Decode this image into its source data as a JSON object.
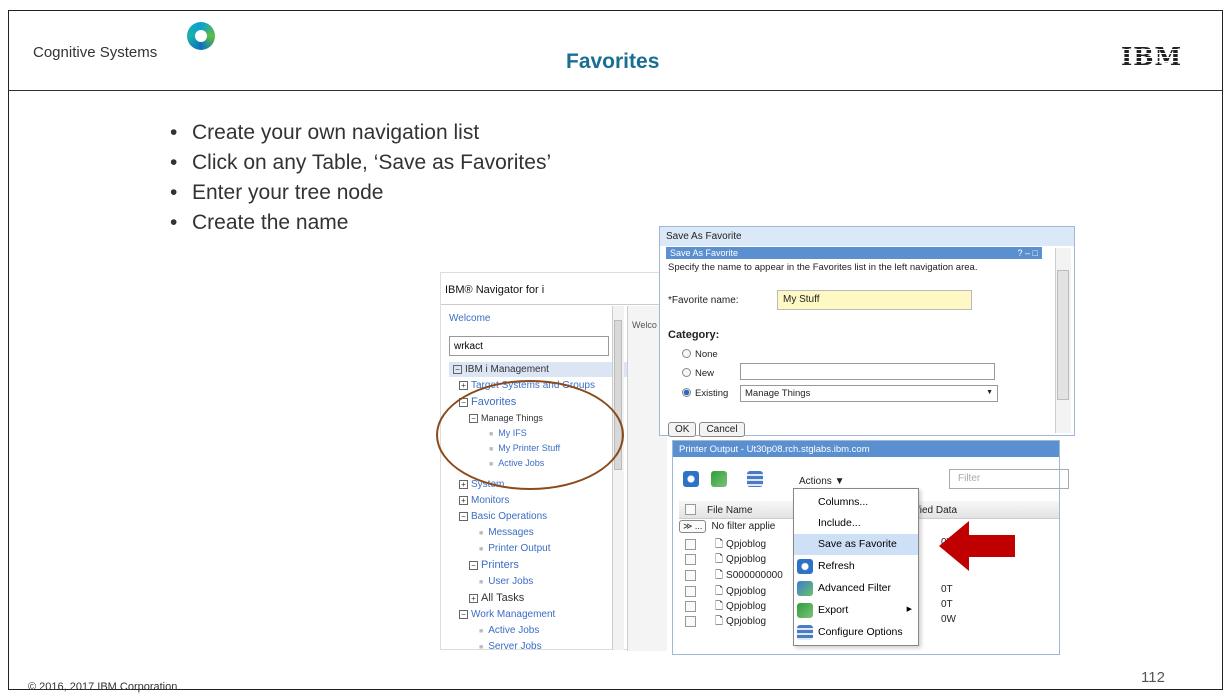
{
  "header": {
    "brand": "Cognitive Systems",
    "title": "Favorites",
    "logo_text": "IBM"
  },
  "bullets": [
    "Create your own navigation list",
    "Click on any Table, ‘Save as Favorites’",
    "Enter your tree node",
    "Create the name"
  ],
  "footer": {
    "copyright": "© 2016, 2017 IBM Corporation",
    "page": "112"
  },
  "navigator": {
    "title": "IBM® Navigator for i",
    "welcome": "Welcome",
    "search_value": "wrkact",
    "root": "IBM i Management",
    "items": [
      "Target Systems and Groups",
      "Favorites",
      "Manage Things",
      "My IFS",
      "My Printer Stuff",
      "Active Jobs",
      "System",
      "Monitors",
      "Basic Operations",
      "Messages",
      "Printer Output",
      "Printers",
      "User Jobs",
      "All Tasks",
      "Work Management",
      "Active Jobs",
      "Server Jobs"
    ],
    "behind_tab": "Welco"
  },
  "dialog": {
    "outer_title": "Save As Favorite",
    "inner_title": "Save As Favorite",
    "controls": "? – □",
    "description": "Specify the name to appear in the Favorites list in the left navigation area.",
    "favorite_name_label": "*Favorite name:",
    "favorite_name_value": "My Stuff",
    "category_label": "Category:",
    "radio_none": "None",
    "radio_new": "New",
    "radio_existing": "Existing",
    "existing_value": "Manage Things",
    "ok": "OK",
    "cancel": "Cancel"
  },
  "printer_output": {
    "title": "Printer Output - Ut30p08.rch.stglabs.ibm.com",
    "actions_label": "Actions ▼",
    "filter_placeholder": "Filter",
    "col_file_name": "File Name",
    "col_modified": "fied Data",
    "filter_button": "≫ ...",
    "filter_text": "No filter applie",
    "rows": [
      {
        "name": "Qpjoblog",
        "tail": "0V"
      },
      {
        "name": "Qpjoblog",
        "tail": ""
      },
      {
        "name": "S000000000",
        "tail": ""
      },
      {
        "name": "Qpjoblog",
        "tail": "0T"
      },
      {
        "name": "Qpjoblog",
        "tail": "0T"
      },
      {
        "name": "Qpjoblog",
        "tail": "0W"
      }
    ]
  },
  "context_menu": {
    "items": [
      "Columns...",
      "Include...",
      "Save as Favorite",
      "Refresh",
      "Advanced Filter",
      "Export",
      "Configure Options"
    ]
  },
  "colors": {
    "title": "#1a6e94",
    "circle": "#8a4a1a",
    "arrow": "#c00000",
    "highlight": "#cde0f6"
  }
}
